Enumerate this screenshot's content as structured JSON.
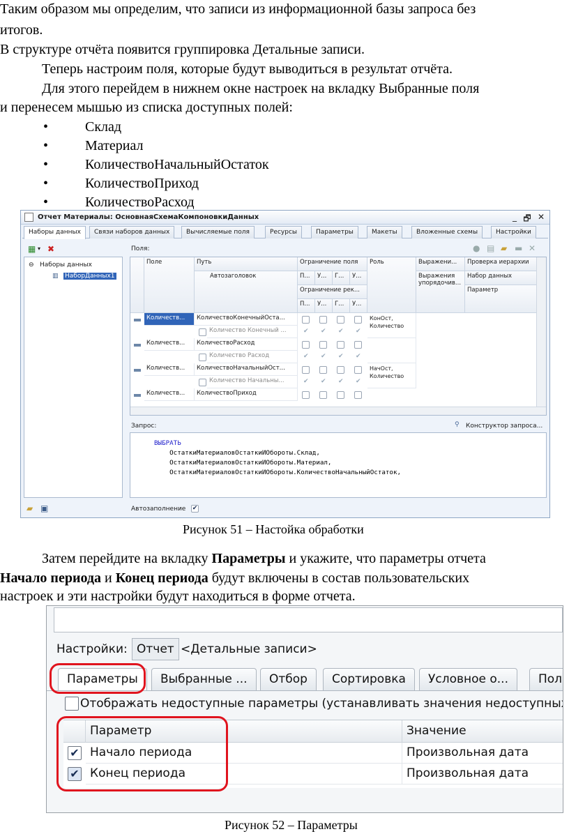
{
  "text": {
    "line1": "Таким образом мы определим, что записи из информационной базы запроса без",
    "line2": "итогов.",
    "line3": "В структуре отчёта появится группировка Детальные записи.",
    "line4": "Теперь настроим поля, которые будут выводиться в результат отчёта.",
    "line5": "Для этого перейдем в нижнем окне настроек на вкладку Выбранные поля",
    "line6": "и перенесем мышью из списка доступных полей:",
    "bullets": [
      "Склад",
      "Материал",
      "КоличествоНачальныйОстаток",
      "КоличествоПриход",
      "КоличествоРасход"
    ],
    "bullet_mark": "•",
    "para2_line1_a": "Затем перейдите на вкладку ",
    "para2_line1_b": "Параметры",
    "para2_line1_c": " и укажите, что параметры отчета",
    "para2_line2_a": "Начало периода",
    "para2_line2_b": " и ",
    "para2_line2_c": "Конец периода",
    "para2_line2_d": " будут включены в состав пользовательских",
    "para2_line3": "настроек и эти настройки будут находиться в форме отчета.",
    "caption51": "Рисунок 51 – Настойка обработки",
    "caption52": "Рисунок 52 – Параметры"
  },
  "fig51": {
    "title": "Отчет Материалы: ОсновнаяСхемаКомпоновкиДанных",
    "controls": [
      "_",
      "🗗",
      "✕"
    ],
    "tabs": [
      "Наборы данных",
      "Связи наборов данных",
      "Вычисляемые поля",
      "Ресурсы",
      "Параметры",
      "Макеты",
      "Вложенные схемы",
      "Настройки"
    ],
    "tree": {
      "root": "Наборы данных",
      "child": "НаборДанных1",
      "expander": "⊖"
    },
    "fields_label": "Поля:",
    "query_label": "Запрос:",
    "query_builder": "Конструктор запроса...",
    "autofill_label": "Автозаполнение",
    "headers": {
      "field": "Поле",
      "path": "Путь",
      "autotitle": "Автозаголовок",
      "restrict_field": "Ограничение поля",
      "restrict_req": "Ограничение рек...",
      "sub": [
        "П...",
        "У...",
        "Г...",
        "У..."
      ],
      "role": "Роль",
      "expr": "Выражени...",
      "expr_order": "Выражения упорядочив...",
      "hier": "Проверка иерархии",
      "dataset": "Набор данных",
      "param": "Параметр"
    },
    "rows": [
      {
        "field": "Количеств...",
        "path": "КоличествоКонечныйОста...",
        "title": "Количество Конечный ...",
        "role": "КонОст, Количество"
      },
      {
        "field": "Количеств...",
        "path": "КоличествоРасход",
        "title": "Количество Расход",
        "role": ""
      },
      {
        "field": "Количеств...",
        "path": "КоличествоНачальныйОст...",
        "title": "Количество Начальны...",
        "role": "НачОст, Количество"
      },
      {
        "field": "Количеств...",
        "path": "КоличествоПриход",
        "title": "",
        "role": ""
      }
    ],
    "query_lines": [
      "ВЫБРАТЬ",
      "    ОстаткиМатериаловОстаткиИОбороты.Склад,",
      "    ОстаткиМатериаловОстаткиИОбороты.Материал,",
      "    ОстаткиМатериаловОстаткиИОбороты.КоличествоНачальныйОстаток,"
    ]
  },
  "fig52": {
    "settings_label": "Настройки:",
    "settings_value": "Отчет",
    "settings_variant": "<Детальные записи>",
    "tabs": [
      "Параметры",
      "Выбранные ...",
      "Отбор",
      "Сортировка",
      "Условное о...",
      "Поля"
    ],
    "show_unavailable": "Отображать недоступные параметры (устанавливать значения недоступных парамет",
    "col_param": "Параметр",
    "col_value": "Значение",
    "rows": [
      {
        "name": "Начало периода",
        "value": "Произвольная дата",
        "checked": true
      },
      {
        "name": "Конец периода",
        "value": "Произвольная дата",
        "checked": true
      }
    ],
    "check_glyph": "✔",
    "highlight_color": "#e0141e"
  }
}
